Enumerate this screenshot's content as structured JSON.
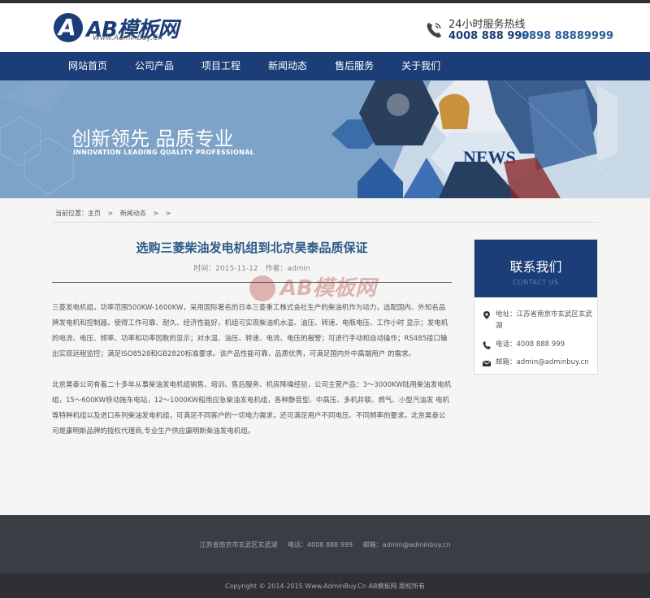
{
  "brand": {
    "logo_text": "AB模板网",
    "logo_sub": "Www.AdminBuy.Cn"
  },
  "hotline": {
    "title": "24小时服务热线",
    "number1": "4008 888 999",
    "number2": "0898 88889999"
  },
  "nav": {
    "items": [
      "网站首页",
      "公司产品",
      "项目工程",
      "新闻动态",
      "售后服务",
      "关于我们"
    ]
  },
  "banner": {
    "title": "创新领先 品质专业",
    "subtitle": "INNOVATION LEADING QUALITY PROFESSIONAL",
    "image_word": "NEWS"
  },
  "breadcrumb": {
    "prefix": "当前位置：",
    "items": [
      "主页",
      ">",
      "新闻动态",
      ">",
      ">"
    ]
  },
  "article": {
    "title": "选购三菱柴油发电机组到北京昊泰品质保证",
    "time_label": "时间：",
    "time_value": "2015-11-12",
    "author_label": "作者：",
    "author_value": "admin",
    "paragraphs": [
      "三菱发电机组，功率范围500KW-1600KW，采用国际著名的日本三菱重工株式会社生产的柴油机作为动力，选配国内、外知名品牌发电机和控制器。使得工作可靠、耐久、经济性能好，机组可实现柴油机水温、油压、转速、电瓶电压、工作小时 显示；发电机的电流、电压、频率、功率和功率因数的显示；对水温、油压、转速、电流、电压的报警；可进行手动和自动操作；RS485接口输出实现远程监控；满足ISO8528和GB2820标准要求。该产品性能可靠，品质优秀，可满足国内外中高端用户 的需求。",
      "北京昊泰公司有着二十多年从事柴油发电机组销售、培训、售后服务、机房降噪经验，公司主营产品：3～3000KW陆用柴油发电机组，15～600KW移动拖车电站，12～1000KW船用应急柴油发电机组，各种静音型、中高压、多机并联、燃气、小型汽油发 电机等特种机组以及进口系列柴油发电机组，可满足不同客户的一切电力需求，还可满足用户不同电压、不同频率的要求。北京昊泰公司是康明斯品牌的授权代理商,专业生产供应康明斯柴油发电机组。"
    ]
  },
  "contact": {
    "title": "联系我们",
    "subtitle": "CONTACT US",
    "address": "地址：江苏省南京市玄武区玄武湖",
    "phone": "电话：4008 888 999",
    "email": "邮箱：admin@adminbuy.cn"
  },
  "footer": {
    "address": "江苏省南京市玄武区玄武湖",
    "phone": "电话：4008 888 999",
    "email": "邮箱：admin@adminbuy.cn",
    "copyright": "Copyright © 2014-2015 Www.AdminBuy.Cn AB模板网 版权所有"
  },
  "colors": {
    "brand_blue": "#1b3d78",
    "banner_blue": "#7aa1c7",
    "footer_dark": "#3a3d44"
  }
}
